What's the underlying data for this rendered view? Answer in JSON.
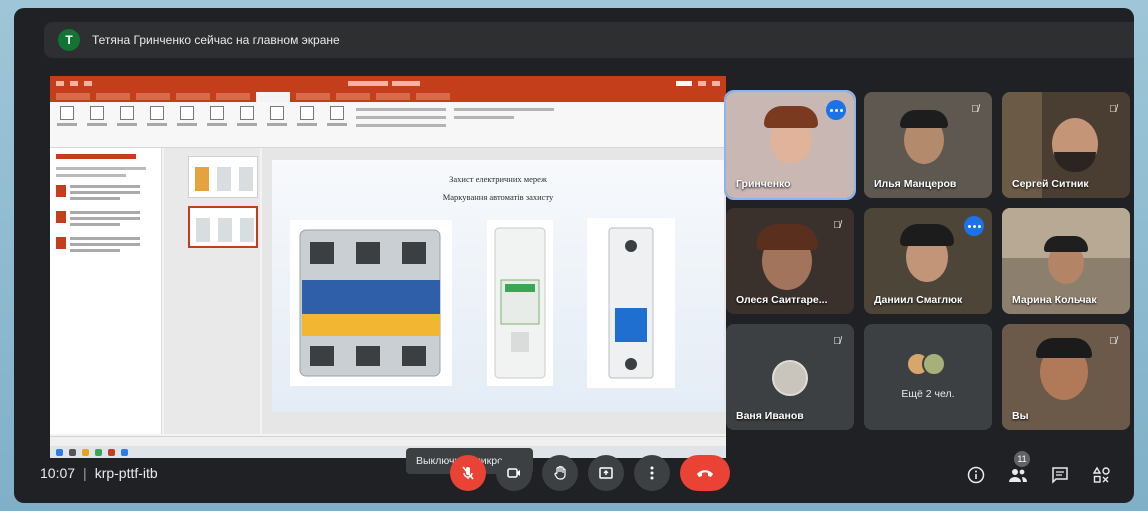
{
  "banner": {
    "avatar_letter": "T",
    "text": "Тетяна Гринченко сейчас на главном экране"
  },
  "presentation": {
    "slide_title": "Захист електричних мереж",
    "slide_subtitle": "Маркування автоматів захисту"
  },
  "participants": [
    {
      "name": "Тетяна Гринченко",
      "display": "Гринченко",
      "speaking": true
    },
    {
      "name": "Илья Манцеров",
      "display": "Илья Манцеров",
      "muted": true
    },
    {
      "name": "Сергей Ситник",
      "display": "Сергей Ситник",
      "muted": true
    },
    {
      "name": "Олеся Саитгаре...",
      "display": "Олеся Саитгаре...",
      "muted": true
    },
    {
      "name": "Даниил Смаглюк",
      "display": "Даниил Смаглюк",
      "active_audio": true
    },
    {
      "name": "Марина Кольчак",
      "display": "Марина Кольчак"
    },
    {
      "name": "Ваня Иванов",
      "display": "Ваня Иванов",
      "muted": true
    },
    {
      "name": "Ещё 2 чел.",
      "display": "Ещё 2 чел."
    },
    {
      "name": "Вы",
      "display": "Вы",
      "muted": true
    }
  ],
  "bottom": {
    "time": "10:07",
    "separator": "|",
    "meeting_code": "krp-pttf-itb",
    "tooltip": "Выключить микрофон",
    "people_count": "11"
  },
  "colors": {
    "accent": "#8ab4f8",
    "danger": "#ea4335",
    "background": "#202124",
    "tile": "#3c4043"
  },
  "icons": {
    "mic_off": "mic-off-icon",
    "camera": "camera-icon",
    "raise_hand": "raise-hand-icon",
    "present": "present-screen-icon",
    "more": "more-options-icon",
    "hang_up": "hang-up-icon",
    "info": "info-icon",
    "people": "people-icon",
    "chat": "chat-icon",
    "activities": "activities-icon"
  }
}
